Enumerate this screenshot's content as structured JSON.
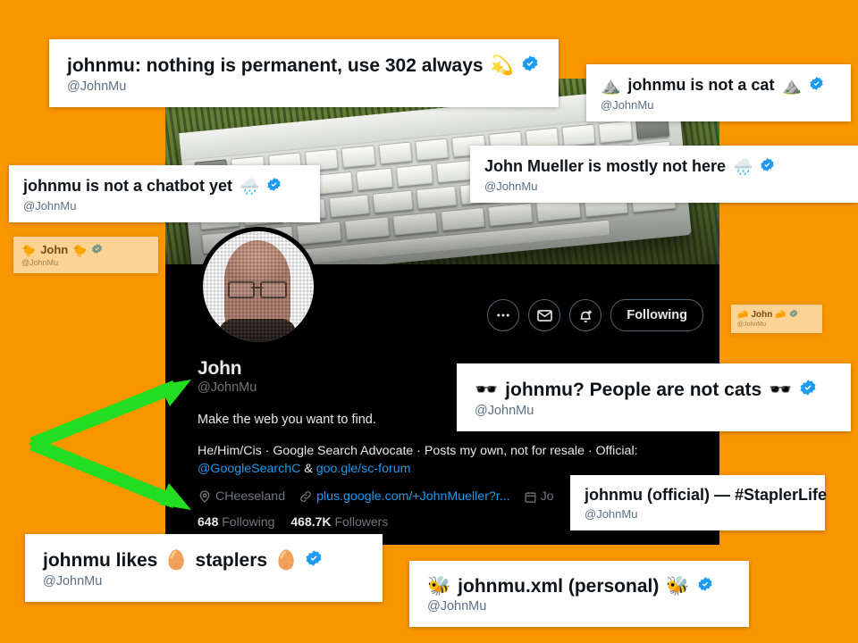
{
  "page": {
    "background_color": "#FA9600",
    "arrow_color": "#22DD22"
  },
  "profile": {
    "display_name": "John",
    "handle": "@JohnMu",
    "bio_main": "Make the web you want to find.",
    "bio_extra_prefix": "He/Him/Cis · Google Search Advocate · Posts my own, not for resale · Official:",
    "bio_link_1": "@GoogleSearchC",
    "bio_link_join": "&",
    "bio_link_2": "goo.gle/sc-forum",
    "location": "CHeeseland",
    "website": "plus.google.com/+JohnMueller?r...",
    "joined": "Jo",
    "following_count": "648",
    "following_label": "Following",
    "followers_count": "468.7K",
    "followers_label": "Followers",
    "banner_alt": "old keyboard lying in grass",
    "avatar_alt": "pixelated portrait of a man with glasses",
    "actions": {
      "more_label": "···",
      "more_icon": "ellipsis-icon",
      "message_icon": "envelope-icon",
      "notify_icon": "bell-plus-icon",
      "follow_state": "Following"
    }
  },
  "cards": [
    {
      "id": "card-302-always",
      "title": "johnmu: nothing is permanent, use 302 always",
      "emoji_leading": "",
      "emoji_trailing": "💫",
      "handle": "@JohnMu",
      "verified": true,
      "size": "big"
    },
    {
      "id": "card-not-a-cat",
      "title": "johnmu is not a cat",
      "emoji_leading": "⛰️",
      "emoji_trailing": "⛰️",
      "handle": "@JohnMu",
      "verified": true,
      "size": "med"
    },
    {
      "id": "card-not-a-chatbot",
      "title": "johnmu is not a chatbot yet",
      "emoji_leading": "",
      "emoji_trailing": "🌧️",
      "handle": "@JohnMu",
      "verified": true,
      "size": "med"
    },
    {
      "id": "card-mostly-not-here",
      "title": "John Mueller is mostly not here",
      "emoji_leading": "",
      "emoji_trailing": "🌧️",
      "handle": "@JohnMu",
      "verified": true,
      "size": "med"
    },
    {
      "id": "card-john-chick",
      "title": "John",
      "emoji_leading": "🐤",
      "emoji_trailing": "🐤",
      "handle": "@JohnMu",
      "verified": true,
      "size": "tiny"
    },
    {
      "id": "card-john-cheese",
      "title": "John",
      "emoji_leading": "🧀",
      "emoji_trailing": "🧀",
      "handle": "@JohnMu",
      "verified": true,
      "size": "micro"
    },
    {
      "id": "card-people-not-cats",
      "title": "johnmu? People are not cats",
      "emoji_leading": "🕶️",
      "emoji_trailing": "🕶️",
      "handle": "@JohnMu",
      "verified": true,
      "size": "big"
    },
    {
      "id": "card-stapler-life",
      "title": "johnmu (official) — #StaplerLife",
      "emoji_leading": "",
      "emoji_trailing": "",
      "handle": "@JohnMu",
      "verified": false,
      "size": "med"
    },
    {
      "id": "card-likes-staplers",
      "title_part_1": "johnmu likes",
      "title_part_2": "staplers",
      "emoji_middle": "🥚",
      "emoji_trailing": "🥚",
      "handle": "@JohnMu",
      "verified": true,
      "size": "big"
    },
    {
      "id": "card-johnmu-xml",
      "title": "johnmu.xml (personal)",
      "emoji_leading": "🐝",
      "emoji_trailing": "🐝",
      "handle": "@JohnMu",
      "verified": true,
      "size": "big"
    }
  ]
}
